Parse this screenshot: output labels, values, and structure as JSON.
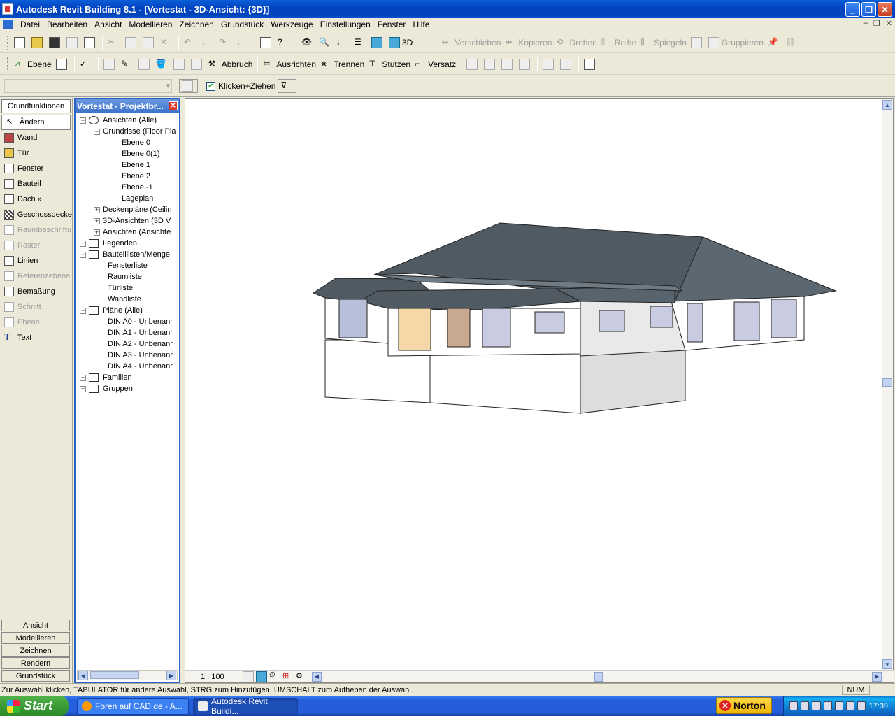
{
  "window": {
    "title": "Autodesk Revit Building 8.1 - [Vortestat - 3D-Ansicht: {3D}]"
  },
  "menu": [
    "Datei",
    "Bearbeiten",
    "Ansicht",
    "Modellieren",
    "Zeichnen",
    "Grundstück",
    "Werkzeuge",
    "Einstellungen",
    "Fenster",
    "Hilfe"
  ],
  "toolbar1": {
    "view3d_label": "3D",
    "verschieben": "Verschieben",
    "kopieren": "Kopieren",
    "drehen": "Drehen",
    "reihe": "Reihe",
    "spiegeln": "Spiegeln",
    "gruppieren": "Gruppieren"
  },
  "toolbar2": {
    "ebene": "Ebene",
    "abbruch": "Abbruch",
    "ausrichten": "Ausrichten",
    "trennen": "Trennen",
    "stutzen": "Stutzen",
    "versatz": "Versatz"
  },
  "options": {
    "klicken_ziehen": "Klicken+Ziehen",
    "checked": true
  },
  "designbar": {
    "header": "Grundfunktionen",
    "items": [
      {
        "label": "Ändern",
        "enabled": true,
        "selected": true,
        "icon": "cursor-icon"
      },
      {
        "label": "Wand",
        "enabled": true,
        "icon": "wall-icon"
      },
      {
        "label": "Tür",
        "enabled": true,
        "icon": "door-icon"
      },
      {
        "label": "Fenster",
        "enabled": true,
        "icon": "window-icon"
      },
      {
        "label": "Bauteil",
        "enabled": true,
        "icon": "component-icon"
      },
      {
        "label": "Dach »",
        "enabled": true,
        "icon": "roof-icon"
      },
      {
        "label": "Geschossdecke",
        "enabled": true,
        "icon": "floor-icon"
      },
      {
        "label": "Raumbeschriftu",
        "enabled": false,
        "icon": "room-tag-icon"
      },
      {
        "label": "Raster",
        "enabled": false,
        "icon": "grid-icon"
      },
      {
        "label": "Linien",
        "enabled": true,
        "icon": "lines-icon"
      },
      {
        "label": "Referenzebene",
        "enabled": false,
        "icon": "ref-plane-icon"
      },
      {
        "label": "Bemaßung",
        "enabled": true,
        "icon": "dimension-icon"
      },
      {
        "label": "Schnitt",
        "enabled": false,
        "icon": "section-icon"
      },
      {
        "label": "Ebene",
        "enabled": false,
        "icon": "level-icon"
      },
      {
        "label": "Text",
        "enabled": true,
        "icon": "text-icon"
      }
    ],
    "tabs": [
      "Ansicht",
      "Modellieren",
      "Zeichnen",
      "Rendern",
      "Grundstück"
    ]
  },
  "browser": {
    "title": "Vortestat - Projektbr...",
    "nodes": [
      {
        "label": "Ansichten (Alle)",
        "level": 0,
        "toggle": "−",
        "icon": "eye-icon"
      },
      {
        "label": "Grundrisse (Floor Pla",
        "level": 1,
        "toggle": "−"
      },
      {
        "label": "Ebene 0",
        "level": 2
      },
      {
        "label": "Ebene 0(1)",
        "level": 2
      },
      {
        "label": "Ebene 1",
        "level": 2
      },
      {
        "label": "Ebene 2",
        "level": 2
      },
      {
        "label": "Ebene -1",
        "level": 2
      },
      {
        "label": "Lageplan",
        "level": 2
      },
      {
        "label": "Deckenpläne (Ceilin",
        "level": 1,
        "toggle": "+"
      },
      {
        "label": "3D-Ansichten (3D V",
        "level": 1,
        "toggle": "+"
      },
      {
        "label": "Ansichten (Ansichte",
        "level": 1,
        "toggle": "+"
      },
      {
        "label": "Legenden",
        "level": 0,
        "toggle": "+",
        "icon": "table-icon"
      },
      {
        "label": "Bauteillisten/Menge",
        "level": 0,
        "toggle": "−",
        "icon": "table-icon"
      },
      {
        "label": "Fensterliste",
        "level": 1
      },
      {
        "label": "Raumliste",
        "level": 1
      },
      {
        "label": "Türliste",
        "level": 1
      },
      {
        "label": "Wandliste",
        "level": 1
      },
      {
        "label": "Pläne (Alle)",
        "level": 0,
        "toggle": "−",
        "icon": "sheet-icon"
      },
      {
        "label": "DIN A0 - Unbenanr",
        "level": 1
      },
      {
        "label": "DIN A1 - Unbenanr",
        "level": 1
      },
      {
        "label": "DIN A2 - Unbenanr",
        "level": 1
      },
      {
        "label": "DIN A3 - Unbenanr",
        "level": 1
      },
      {
        "label": "DIN A4 - Unbenanr",
        "level": 1
      },
      {
        "label": "Familien",
        "level": 0,
        "toggle": "+",
        "icon": "family-icon"
      },
      {
        "label": "Gruppen",
        "level": 0,
        "toggle": "+",
        "icon": "group-icon"
      }
    ]
  },
  "view": {
    "scale": "1 : 100"
  },
  "status": {
    "message": "Zur Auswahl klicken, TABULATOR für andere Auswahl, STRG zum Hinzufügen, UMSCHALT zum Aufheben der Auswahl.",
    "num": "NUM"
  },
  "taskbar": {
    "start": "Start",
    "tasks": [
      "Foren auf CAD.de - A...",
      "Autodesk Revit Buildi..."
    ],
    "norton": "Norton",
    "clock": "17:39"
  }
}
